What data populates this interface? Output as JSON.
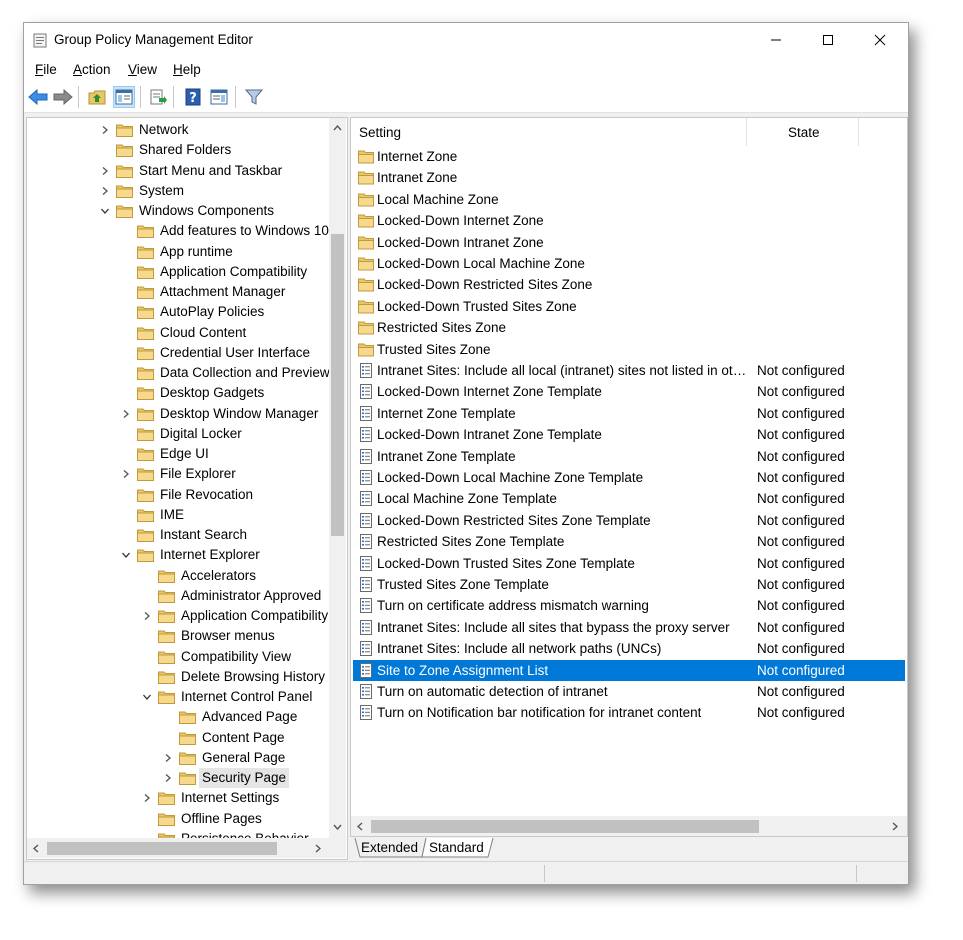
{
  "window": {
    "title": "Group Policy Management Editor"
  },
  "menu": [
    {
      "pre": "",
      "u": "F",
      "post": "ile"
    },
    {
      "pre": "",
      "u": "A",
      "post": "ction"
    },
    {
      "pre": "",
      "u": "V",
      "post": "iew"
    },
    {
      "pre": "",
      "u": "H",
      "post": "elp"
    }
  ],
  "toolbar": [
    "back-icon",
    "forward-icon",
    "up-folder-icon",
    "show-hide-tree-icon",
    "export-list-icon",
    "help-icon",
    "properties-pane-icon",
    "filter-icon"
  ],
  "tree": [
    {
      "label": "Network",
      "level": 3,
      "expander": "collapsed"
    },
    {
      "label": "Shared Folders",
      "level": 3,
      "expander": "none"
    },
    {
      "label": "Start Menu and Taskbar",
      "level": 3,
      "expander": "collapsed"
    },
    {
      "label": "System",
      "level": 3,
      "expander": "collapsed"
    },
    {
      "label": "Windows Components",
      "level": 3,
      "expander": "expanded"
    },
    {
      "label": "Add features to Windows 10",
      "level": 4,
      "expander": "none"
    },
    {
      "label": "App runtime",
      "level": 4,
      "expander": "none"
    },
    {
      "label": "Application Compatibility",
      "level": 4,
      "expander": "none"
    },
    {
      "label": "Attachment Manager",
      "level": 4,
      "expander": "none"
    },
    {
      "label": "AutoPlay Policies",
      "level": 4,
      "expander": "none"
    },
    {
      "label": "Cloud Content",
      "level": 4,
      "expander": "none"
    },
    {
      "label": "Credential User Interface",
      "level": 4,
      "expander": "none"
    },
    {
      "label": "Data Collection and Preview",
      "level": 4,
      "expander": "none"
    },
    {
      "label": "Desktop Gadgets",
      "level": 4,
      "expander": "none"
    },
    {
      "label": "Desktop Window Manager",
      "level": 4,
      "expander": "collapsed"
    },
    {
      "label": "Digital Locker",
      "level": 4,
      "expander": "none"
    },
    {
      "label": "Edge UI",
      "level": 4,
      "expander": "none"
    },
    {
      "label": "File Explorer",
      "level": 4,
      "expander": "collapsed"
    },
    {
      "label": "File Revocation",
      "level": 4,
      "expander": "none"
    },
    {
      "label": "IME",
      "level": 4,
      "expander": "none"
    },
    {
      "label": "Instant Search",
      "level": 4,
      "expander": "none"
    },
    {
      "label": "Internet Explorer",
      "level": 4,
      "expander": "expanded"
    },
    {
      "label": "Accelerators",
      "level": 5,
      "expander": "none"
    },
    {
      "label": "Administrator Approved",
      "level": 5,
      "expander": "none"
    },
    {
      "label": "Application Compatibility",
      "level": 5,
      "expander": "collapsed"
    },
    {
      "label": "Browser menus",
      "level": 5,
      "expander": "none"
    },
    {
      "label": "Compatibility View",
      "level": 5,
      "expander": "none"
    },
    {
      "label": "Delete Browsing History",
      "level": 5,
      "expander": "none"
    },
    {
      "label": "Internet Control Panel",
      "level": 5,
      "expander": "expanded"
    },
    {
      "label": "Advanced Page",
      "level": 6,
      "expander": "none"
    },
    {
      "label": "Content Page",
      "level": 6,
      "expander": "none"
    },
    {
      "label": "General Page",
      "level": 6,
      "expander": "collapsed"
    },
    {
      "label": "Security Page",
      "level": 6,
      "expander": "collapsed",
      "selected": true
    },
    {
      "label": "Internet Settings",
      "level": 5,
      "expander": "collapsed"
    },
    {
      "label": "Offline Pages",
      "level": 5,
      "expander": "none"
    },
    {
      "label": "Persistence Behavior",
      "level": 5,
      "expander": "none"
    }
  ],
  "columns": {
    "setting": "Setting",
    "state": "State"
  },
  "settings": [
    {
      "name": "Internet Zone",
      "state": "",
      "kind": "folder"
    },
    {
      "name": "Intranet Zone",
      "state": "",
      "kind": "folder"
    },
    {
      "name": "Local Machine Zone",
      "state": "",
      "kind": "folder"
    },
    {
      "name": "Locked-Down Internet Zone",
      "state": "",
      "kind": "folder"
    },
    {
      "name": "Locked-Down Intranet Zone",
      "state": "",
      "kind": "folder"
    },
    {
      "name": "Locked-Down Local Machine Zone",
      "state": "",
      "kind": "folder"
    },
    {
      "name": "Locked-Down Restricted Sites Zone",
      "state": "",
      "kind": "folder"
    },
    {
      "name": "Locked-Down Trusted Sites Zone",
      "state": "",
      "kind": "folder"
    },
    {
      "name": "Restricted Sites Zone",
      "state": "",
      "kind": "folder"
    },
    {
      "name": "Trusted Sites Zone",
      "state": "",
      "kind": "folder"
    },
    {
      "name": "Intranet Sites: Include all local (intranet) sites not listed in oth...",
      "state": "Not configured",
      "kind": "policy"
    },
    {
      "name": "Locked-Down Internet Zone Template",
      "state": "Not configured",
      "kind": "policy"
    },
    {
      "name": "Internet Zone Template",
      "state": "Not configured",
      "kind": "policy"
    },
    {
      "name": "Locked-Down Intranet Zone Template",
      "state": "Not configured",
      "kind": "policy"
    },
    {
      "name": "Intranet Zone Template",
      "state": "Not configured",
      "kind": "policy"
    },
    {
      "name": "Locked-Down Local Machine Zone Template",
      "state": "Not configured",
      "kind": "policy"
    },
    {
      "name": "Local Machine Zone Template",
      "state": "Not configured",
      "kind": "policy"
    },
    {
      "name": "Locked-Down Restricted Sites Zone Template",
      "state": "Not configured",
      "kind": "policy"
    },
    {
      "name": "Restricted Sites Zone Template",
      "state": "Not configured",
      "kind": "policy"
    },
    {
      "name": "Locked-Down Trusted Sites Zone Template",
      "state": "Not configured",
      "kind": "policy"
    },
    {
      "name": "Trusted Sites Zone Template",
      "state": "Not configured",
      "kind": "policy"
    },
    {
      "name": "Turn on certificate address mismatch warning",
      "state": "Not configured",
      "kind": "policy"
    },
    {
      "name": "Intranet Sites: Include all sites that bypass the proxy server",
      "state": "Not configured",
      "kind": "policy"
    },
    {
      "name": "Intranet Sites: Include all network paths (UNCs)",
      "state": "Not configured",
      "kind": "policy"
    },
    {
      "name": "Site to Zone Assignment List",
      "state": "Not configured",
      "kind": "policy",
      "selected": true
    },
    {
      "name": "Turn on automatic detection of intranet",
      "state": "Not configured",
      "kind": "policy"
    },
    {
      "name": "Turn on Notification bar notification for intranet content",
      "state": "Not configured",
      "kind": "policy"
    }
  ],
  "tabs": [
    {
      "label": "Extended",
      "active": false
    },
    {
      "label": "Standard",
      "active": true
    }
  ],
  "colors": {
    "selection": "#0078d7",
    "folder": "#e8c76a",
    "tree_selection": "#e5e5e5"
  }
}
